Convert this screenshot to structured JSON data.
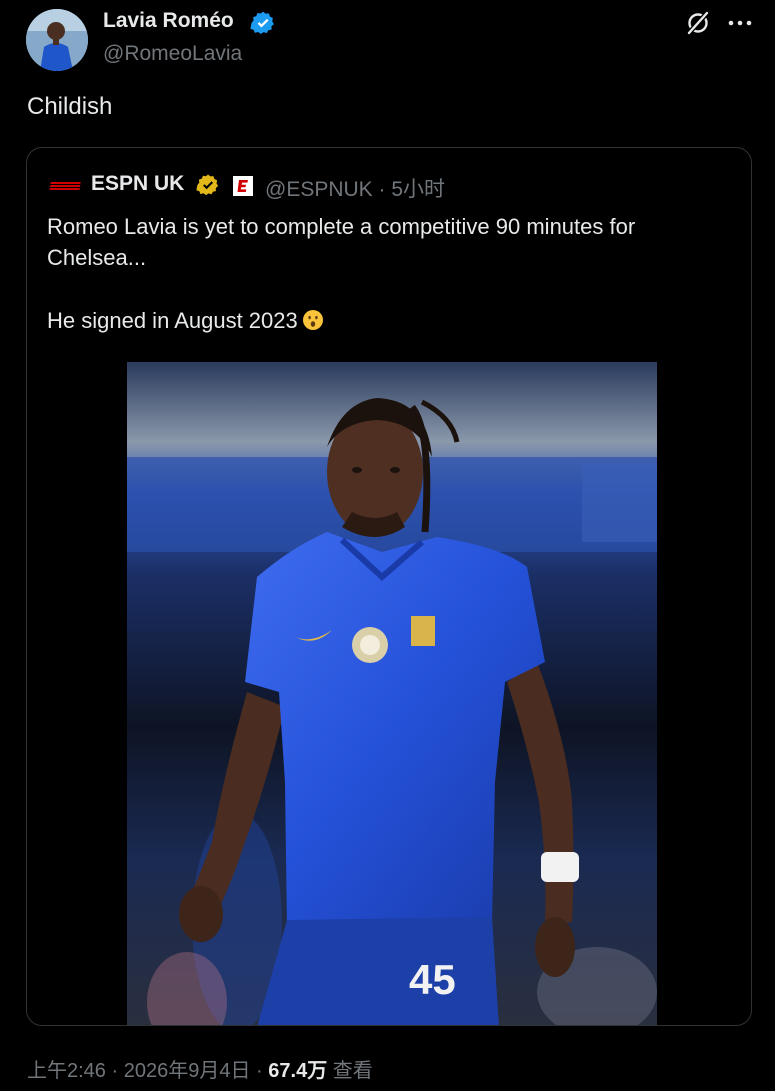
{
  "tweet": {
    "author_name": "Lavia Roméo",
    "author_handle": "@RomeoLavia",
    "text": "Childish",
    "time": "上午2:46",
    "separator": "·",
    "date": "2026年9月4日",
    "views_count": "67.4万",
    "views_label": "查看"
  },
  "quoted_tweet": {
    "author_name": "ESPN UK",
    "author_handle": "@ESPNUK",
    "separator": "·",
    "time_ago": "5小时",
    "text_line1": "Romeo Lavia is yet to complete a competitive 90 minutes for Chelsea...",
    "text_line2": "He signed in August 2023",
    "shirt_number": "45"
  },
  "icons": {
    "verified": "verified-badge-icon",
    "gold_verified": "gold-verified-badge-icon",
    "grok": "grok-icon",
    "more": "more-options-icon",
    "emoji": "surprised-face-emoji",
    "espn_logo": "espn-logo",
    "espn_e": "espn-e-icon"
  },
  "colors": {
    "background": "#000000",
    "text_primary": "#e7e9ea",
    "text_secondary": "#71767b",
    "border": "#2f3336",
    "verified_blue": "#1d9bf0",
    "verified_gold": "#e2b719",
    "espn_red": "#d00000",
    "jersey_blue": "#1f4fd8"
  }
}
